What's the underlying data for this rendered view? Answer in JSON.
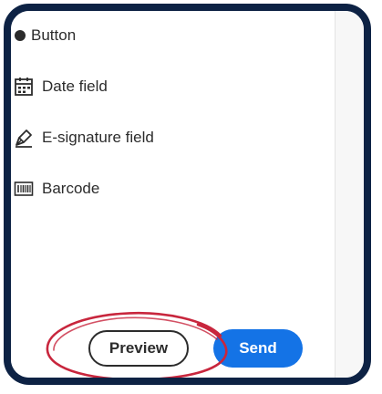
{
  "field_list": {
    "items": [
      {
        "label": "Button",
        "icon": "button-radio-icon"
      },
      {
        "label": "Date field",
        "icon": "calendar-icon"
      },
      {
        "label": "E-signature field",
        "icon": "pen-signature-icon"
      },
      {
        "label": "Barcode",
        "icon": "barcode-icon"
      }
    ]
  },
  "actions": {
    "preview_label": "Preview",
    "send_label": "Send"
  },
  "colors": {
    "frame_border": "#0d2244",
    "send_button": "#1473e6",
    "annotation_circle": "#c8263d"
  }
}
